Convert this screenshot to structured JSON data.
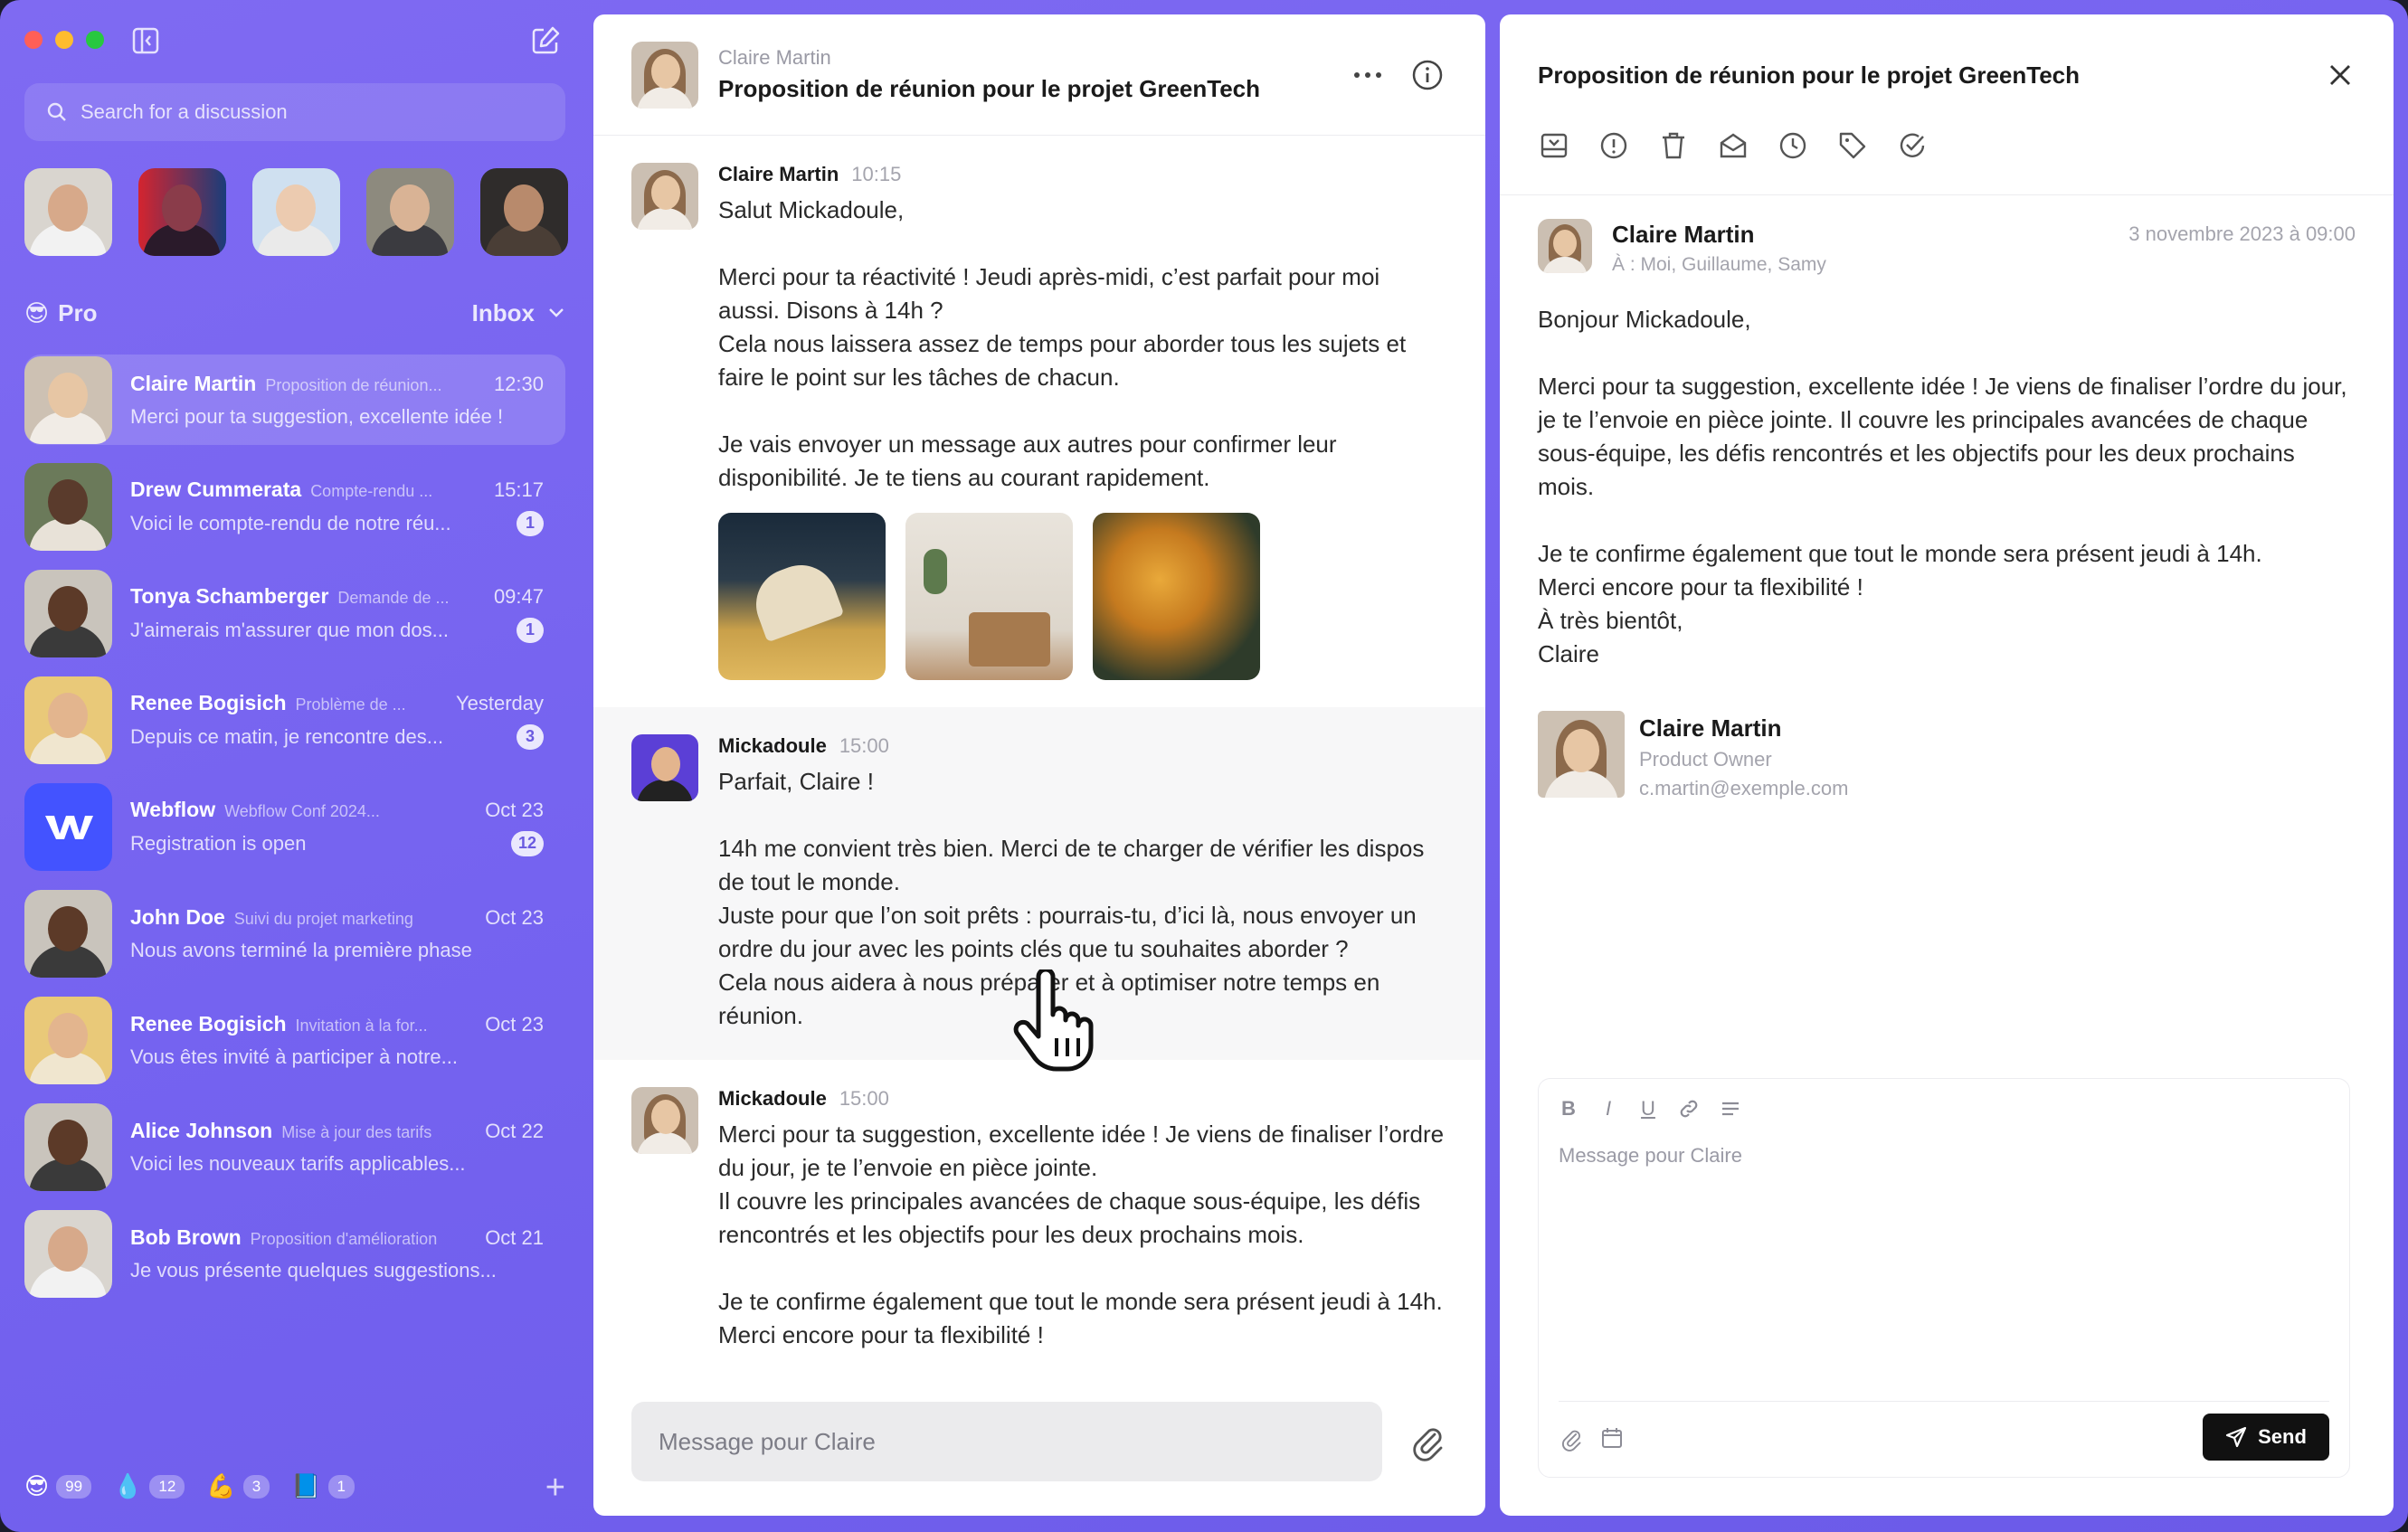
{
  "sidebar": {
    "search_placeholder": "Search for a discussion",
    "section_emoji": "😎",
    "section_title": "Pro",
    "inbox_label": "Inbox",
    "conversations": [
      {
        "name": "Claire Martin",
        "subject": "Proposition de réunion...",
        "time": "12:30",
        "preview": "Merci pour ta suggestion, excellente idée !",
        "badge": ""
      },
      {
        "name": "Drew Cummerata",
        "subject": "Compte-rendu ...",
        "time": "15:17",
        "preview": "Voici le compte-rendu de notre réu...",
        "badge": "1"
      },
      {
        "name": "Tonya Schamberger",
        "subject": "Demande de ...",
        "time": "09:47",
        "preview": "J'aimerais m'assurer que mon dos...",
        "badge": "1"
      },
      {
        "name": "Renee Bogisich",
        "subject": "Problème de ...",
        "time": "Yesterday",
        "preview": "Depuis ce matin, je rencontre des...",
        "badge": "3"
      },
      {
        "name": "Webflow",
        "subject": "Webflow Conf 2024...",
        "time": "Oct 23",
        "preview": "Registration is open",
        "badge": "12"
      },
      {
        "name": "John Doe",
        "subject": "Suivi du projet marketing",
        "time": "Oct 23",
        "preview": "Nous avons terminé la première phase",
        "badge": ""
      },
      {
        "name": "Renee Bogisich",
        "subject": "Invitation à la for...",
        "time": "Oct 23",
        "preview": "Vous êtes invité à participer à notre...",
        "badge": ""
      },
      {
        "name": "Alice Johnson",
        "subject": "Mise à jour des tarifs",
        "time": "Oct 22",
        "preview": "Voici les nouveaux tarifs applicables...",
        "badge": ""
      },
      {
        "name": "Bob Brown",
        "subject": "Proposition d'amélioration",
        "time": "Oct 21",
        "preview": "Je vous présente quelques suggestions...",
        "badge": ""
      }
    ],
    "footer": [
      {
        "emoji": "😎",
        "count": "99"
      },
      {
        "emoji": "💧",
        "count": "12"
      },
      {
        "emoji": "💪",
        "count": "3"
      },
      {
        "emoji": "📘",
        "count": "1"
      }
    ],
    "footer_plus": "+"
  },
  "thread": {
    "from": "Claire Martin",
    "subject": "Proposition de réunion pour le projet GreenTech",
    "messages": [
      {
        "author": "Claire Martin",
        "time": "10:15",
        "text": "Salut Mickadoule,\n\nMerci pour ta réactivité ! Jeudi après-midi, c’est parfait pour moi aussi. Disons à 14h ?\nCela nous laissera assez de temps pour aborder tous les sujets et faire le point sur les tâches de chacun.\n\nJe vais envoyer un message aux autres pour confirmer leur disponibilité. Je te tiens au courant rapidement."
      },
      {
        "author": "Mickadoule",
        "time": "15:00",
        "text": "Parfait, Claire !\n\n14h me convient très bien. Merci de te charger de vérifier les dispos de tout le monde.\nJuste pour que l’on soit prêts : pourrais-tu, d’ici là, nous envoyer un ordre du jour avec les points clés que tu souhaites aborder ?\nCela nous aidera à nous préparer et à optimiser notre temps en réunion."
      },
      {
        "author": "Mickadoule",
        "time": "15:00",
        "text": "Merci pour ta suggestion, excellente idée ! Je viens de finaliser l’ordre du jour, je te l’envoie en pièce jointe.\nIl couvre les principales avancées de chaque sous-équipe, les défis rencontrés et les objectifs pour les deux prochains mois.\n\nJe te confirme également que tout le monde sera présent jeudi à 14h. Merci encore pour ta flexibilité !"
      }
    ],
    "composer_placeholder": "Message pour Claire"
  },
  "detail": {
    "title": "Proposition de réunion pour le projet GreenTech",
    "sender": "Claire Martin",
    "recipients": "À : Moi, Guillaume, Samy",
    "date": "3 novembre 2023 à 09:00",
    "body": "Bonjour Mickadoule,\n\nMerci pour ta suggestion, excellente idée ! Je viens de finaliser l’ordre du jour, je te l’envoie en pièce jointe. Il couvre les principales avancées de chaque sous-équipe, les défis rencontrés et les objectifs pour les deux prochains mois.\n\nJe te confirme également que tout le monde sera présent jeudi à 14h.\nMerci encore pour ta flexibilité !\nÀ très bientôt,\nClaire",
    "signature": {
      "name": "Claire Martin",
      "role": "Product Owner",
      "email": "c.martin@exemple.com"
    },
    "composer_placeholder": "Message pour Claire",
    "format_buttons": [
      "B",
      "I",
      "U"
    ],
    "send_label": "Send"
  },
  "colors": {
    "accent": "#7563f0",
    "send": "#111111",
    "webflow": "#4353ff"
  }
}
